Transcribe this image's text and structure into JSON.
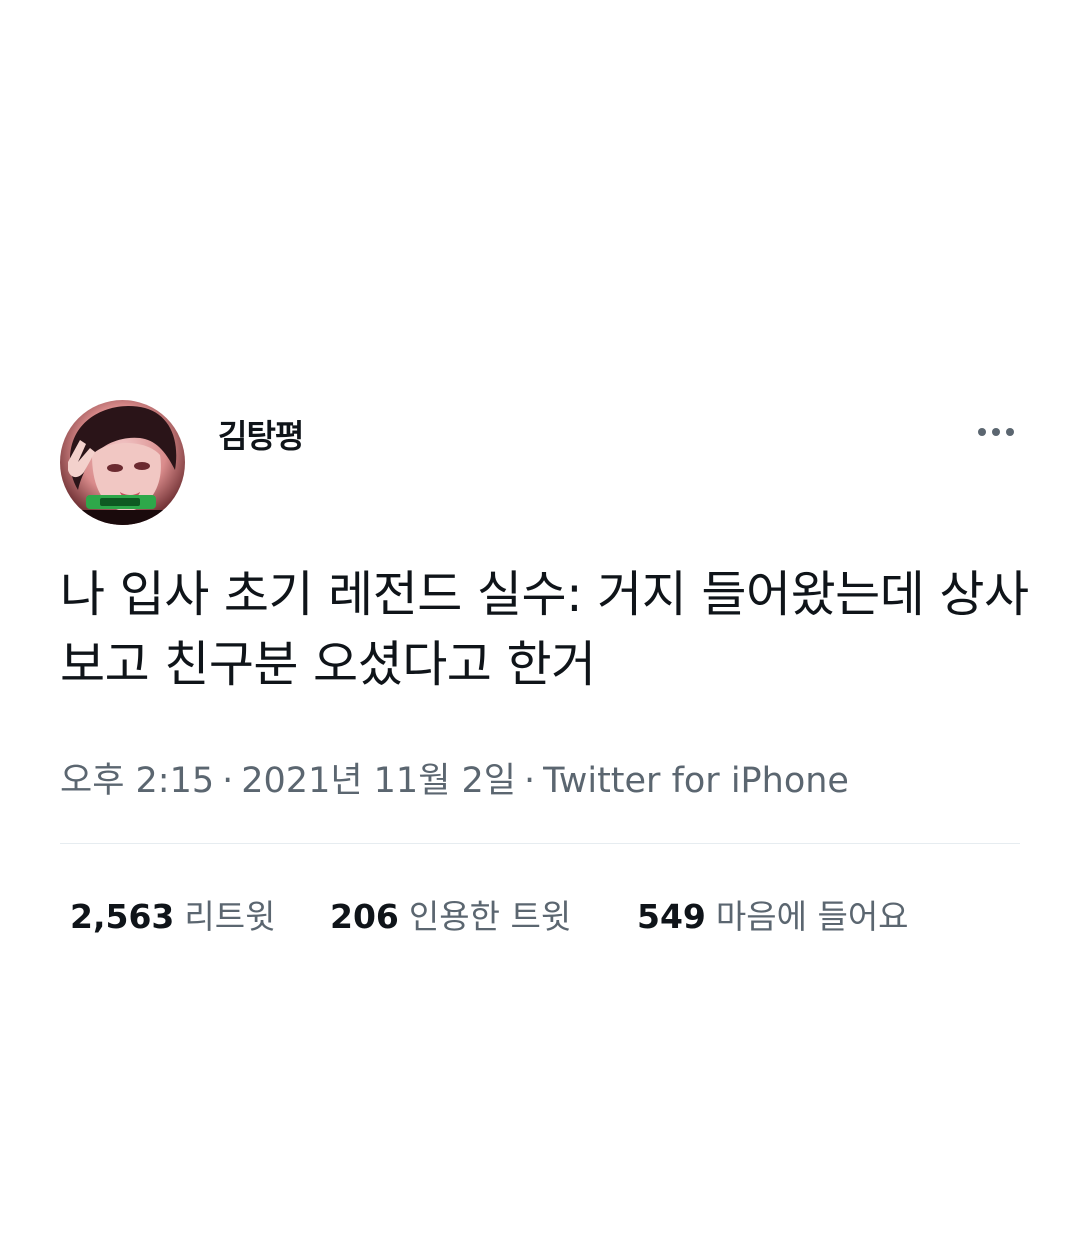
{
  "user": {
    "display_name": "김탕평"
  },
  "tweet": {
    "text": "나 입사 초기 레전드 실수: 거지 들어왔는데 상사 보고 친구분 오셨다고 한거",
    "time": "오후 2:15",
    "date": "2021년 11월 2일",
    "source": "Twitter for iPhone",
    "separator": "·"
  },
  "stats": {
    "retweets": {
      "count": "2,563",
      "label": "리트윗"
    },
    "quotes": {
      "count": "206",
      "label": "인용한 트윗"
    },
    "likes": {
      "count": "549",
      "label": "마음에 들어요"
    }
  },
  "icons": {
    "more": "more-horizontal-icon"
  },
  "colors": {
    "text_primary": "#0f1419",
    "text_secondary": "#5b6670",
    "divider": "#e6ecf0"
  }
}
